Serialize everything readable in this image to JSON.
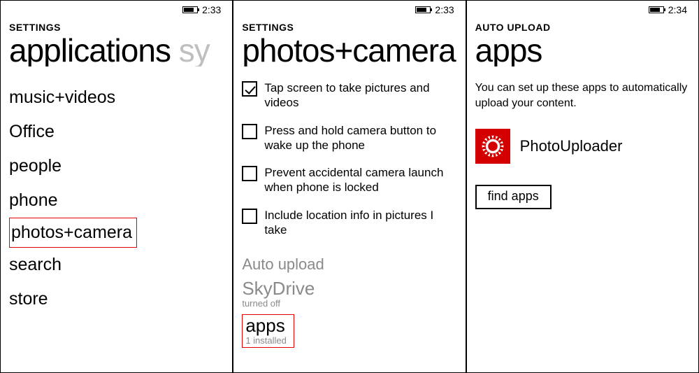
{
  "screens": {
    "s1": {
      "time": "2:33",
      "header": "SETTINGS",
      "pivot_active": "applications",
      "pivot_next": " sy",
      "items": [
        "music+videos",
        "Office",
        "people",
        "phone",
        "photos+camera",
        "search",
        "store"
      ],
      "highlight_index": 4
    },
    "s2": {
      "time": "2:33",
      "header": "SETTINGS",
      "pivot_active": "photos+camera",
      "checks": [
        {
          "label": "Tap screen to take pictures and videos",
          "checked": true
        },
        {
          "label": "Press and hold camera button to wake up the phone",
          "checked": false
        },
        {
          "label": "Prevent accidental camera launch when phone is locked",
          "checked": false
        },
        {
          "label": "Include location info in pictures I take",
          "checked": false
        }
      ],
      "section": "Auto upload",
      "skydrive": {
        "title": "SkyDrive",
        "status": "turned off"
      },
      "apps": {
        "title": "apps",
        "status": "1 installed"
      }
    },
    "s3": {
      "time": "2:34",
      "header": "AUTO UPLOAD",
      "pivot_active": "apps",
      "desc": "You can set up these apps to automatically upload your content.",
      "app": {
        "name": "PhotoUploader"
      },
      "button": "find apps"
    }
  }
}
